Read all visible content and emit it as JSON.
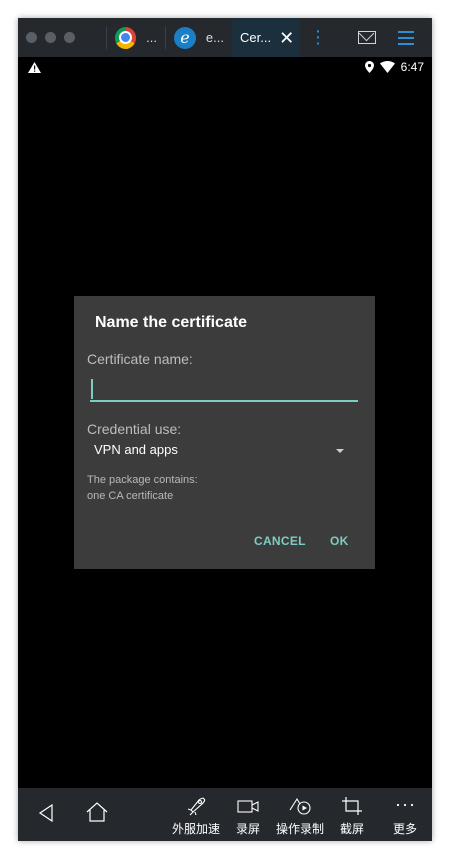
{
  "titlebar": {
    "tabs": [
      {
        "label": "...",
        "icon": "chrome-icon"
      },
      {
        "label": "e...",
        "icon": "ie-icon"
      },
      {
        "label": "Cer..."
      }
    ]
  },
  "statusbar": {
    "time": "6:47"
  },
  "dialog": {
    "title": "Name the certificate",
    "cert_name_label": "Certificate name:",
    "cert_name_value": "",
    "credential_label": "Credential use:",
    "credential_value": "VPN and apps",
    "package_line1": "The package contains:",
    "package_line2": "one CA certificate",
    "cancel": "CANCEL",
    "ok": "OK"
  },
  "bottombar": {
    "items": [
      {
        "label": "外服加速",
        "icon": "rocket-icon"
      },
      {
        "label": "录屏",
        "icon": "video-icon"
      },
      {
        "label": "操作录制",
        "icon": "record-icon"
      },
      {
        "label": "截屏",
        "icon": "crop-icon"
      },
      {
        "label": "更多",
        "icon": "more-icon"
      }
    ]
  },
  "colors": {
    "accent": "#80cbc4",
    "dialog_bg": "#3c3c3c",
    "chrome_bg": "#25292e",
    "tab_active": "#1b2f3d"
  }
}
